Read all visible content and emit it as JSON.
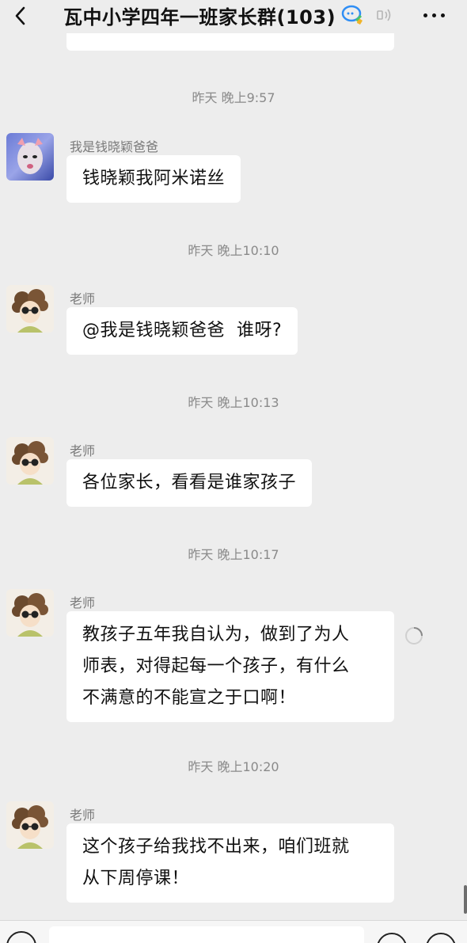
{
  "header": {
    "title": "瓦中小学四年一班家长群(103)",
    "back_icon": "chevron-left-icon",
    "group_icon": "chat-group-icon",
    "speaker_icon": "speaker-icon",
    "more_icon": "more-icon"
  },
  "messages": [
    {
      "time": "昨天 晚上9:57",
      "sender": "我是钱晓颖爸爸",
      "text": "钱晓颖我阿米诺丝"
    },
    {
      "time": "昨天 晚上10:10",
      "sender": "老师",
      "text": "@我是钱晓颖爸爸  谁呀?"
    },
    {
      "time": "昨天 晚上10:13",
      "sender": "老师",
      "text": "各位家长，看看是谁家孩子"
    },
    {
      "time": "昨天 晚上10:17",
      "sender": "老师",
      "lines": [
        "教孩子五年我自认为，做到了为人",
        "师表，对得起每一个孩子，有什么",
        "不满意的不能宣之于口啊！"
      ]
    },
    {
      "time": "昨天 晚上10:20",
      "sender": "老师",
      "lines": [
        "这个孩子给我找不出来，咱们班就",
        "从下周停课！"
      ]
    }
  ],
  "colors": {
    "background": "#ededed",
    "bubble": "#ffffff",
    "timestamp": "#8a8a8a",
    "sender": "#7a7a7a"
  }
}
